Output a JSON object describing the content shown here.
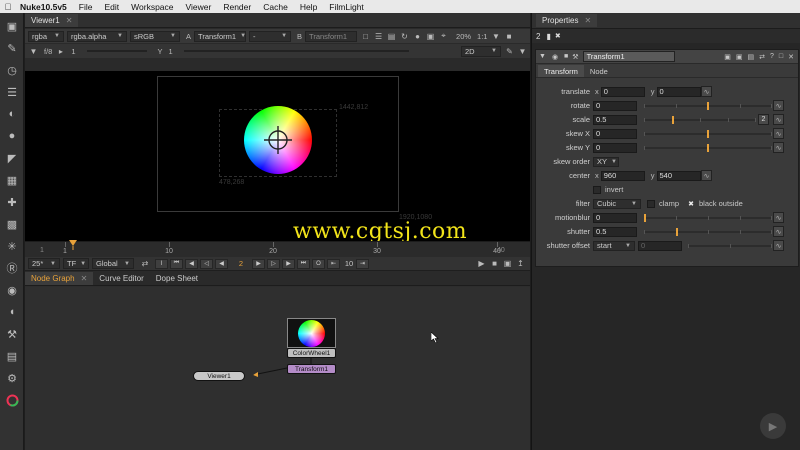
{
  "menubar": {
    "app_name": "Nuke10.5v5",
    "items": [
      "File",
      "Edit",
      "Workspace",
      "Viewer",
      "Render",
      "Cache",
      "Help",
      "FilmLight"
    ]
  },
  "viewer": {
    "tab_label": "Viewer1",
    "controls": {
      "channels": "rgba",
      "alpha": "rgba.alpha",
      "colorspace": "sRGB",
      "input_a_letter": "A",
      "input_a": "Transform1",
      "op": "-",
      "input_b_letter": "B",
      "input_b": "Transform1",
      "zoom": "20%",
      "ratio": "1:1",
      "fstop": "f/8",
      "gain": "1",
      "y_label": "Y",
      "gamma": "1",
      "view_mode": "2D"
    },
    "bbox_top_right": "1442,812",
    "bbox_bottom_left": "478,268",
    "format_corner": "1920,1080",
    "watermark": "www.cgtsj.com",
    "timeline": {
      "start": "1",
      "end": "40",
      "ticks": [
        "1",
        "10",
        "20",
        "30",
        "40"
      ]
    },
    "transport": {
      "fps": "25*",
      "tf": "TF",
      "range": "Global",
      "current_frame": "2",
      "increment": "10"
    }
  },
  "node_graph": {
    "tabs": [
      "Node Graph",
      "Curve Editor",
      "Dope Sheet"
    ],
    "nodes": {
      "colorwheel": "ColorWheel1",
      "transform": "Transform1",
      "viewer": "Viewer1"
    }
  },
  "properties": {
    "title": "Properties",
    "max_panels": "2",
    "node_name": "Transform1",
    "tabs": [
      "Transform",
      "Node"
    ],
    "translate": {
      "label": "translate",
      "x_label": "x",
      "x": "0",
      "y_label": "y",
      "y": "0"
    },
    "rotate": {
      "label": "rotate",
      "value": "0"
    },
    "scale": {
      "label": "scale",
      "value": "0.5",
      "channels": "2"
    },
    "skew_x": {
      "label": "skew X",
      "value": "0"
    },
    "skew_y": {
      "label": "skew Y",
      "value": "0"
    },
    "skew_order": {
      "label": "skew order",
      "value": "XY"
    },
    "center": {
      "label": "center",
      "x_label": "x",
      "x": "960",
      "y_label": "y",
      "y": "540"
    },
    "invert": {
      "label": "invert"
    },
    "filter": {
      "label": "filter",
      "value": "Cubic",
      "clamp": "clamp",
      "black_outside": "black outside"
    },
    "motionblur": {
      "label": "motionblur",
      "value": "0"
    },
    "shutter": {
      "label": "shutter",
      "value": "0.5"
    },
    "shutter_offset": {
      "label": "shutter offset",
      "value": "start",
      "custom": "0"
    }
  },
  "colors": {
    "accent": "#e8a23a",
    "watermark": "#f2e41a",
    "node_transform": "#b48cc8",
    "node_viewer": "#c8c8c8"
  }
}
